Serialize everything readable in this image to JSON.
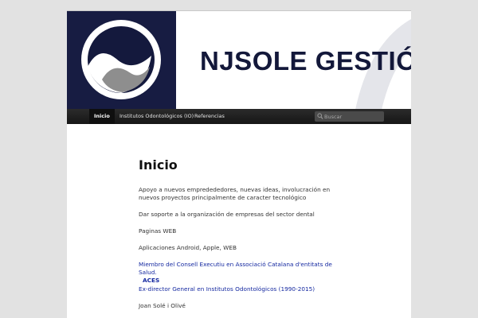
{
  "site": {
    "brand_text": "NJSOLE GESTIÓ",
    "logo_icon": "njsole-wave-logo",
    "colors": {
      "navy": "#14193d",
      "nav_dark": "#1a1a1a",
      "link": "#1428a0",
      "page_bg": "#e2e2e2"
    }
  },
  "nav": {
    "items": [
      {
        "label": "Inicio",
        "active": true
      },
      {
        "label": "Institutos Odontológicos (IO)",
        "active": false
      },
      {
        "label": "Referencias",
        "active": false
      }
    ],
    "search_placeholder": "Buscar"
  },
  "main": {
    "title": "Inicio",
    "paragraphs": [
      "Apoyo a nuevos empredededores, nuevas ideas, involucración en nuevos proyectos principalmente de caracter tecnológico",
      "Dar soporte a la organización de empresas del sector dental",
      "Paginas WEB",
      "Aplicaciones Android, Apple, WEB"
    ],
    "links": {
      "consell": "Miembro del Consell Executiu en Associació Catalana d'entitats de Salud.",
      "aces": "ACES",
      "exdirector": "Ex-director General en Institutos Odontológicos (1990-2015)"
    },
    "signature": "Joan Solé i Olivé"
  }
}
